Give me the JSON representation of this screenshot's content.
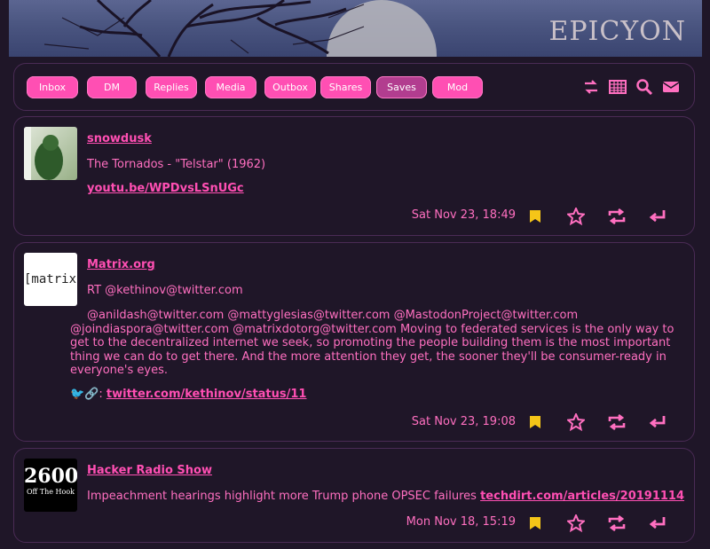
{
  "header": {
    "brand": "EPICYON"
  },
  "nav": {
    "tabs": [
      {
        "label": "Inbox"
      },
      {
        "label": "DM"
      },
      {
        "label": "Replies"
      },
      {
        "label": "Media"
      },
      {
        "label": "Outbox"
      },
      {
        "label": "Shares"
      },
      {
        "label": "Saves",
        "active": true
      },
      {
        "label": "Mod"
      }
    ],
    "icons": [
      "swap-icon",
      "calendar-icon",
      "search-icon",
      "email-icon"
    ]
  },
  "posts": [
    {
      "author": "snowdusk",
      "lines": [
        "The Tornados - \"Telstar\" (1962)"
      ],
      "link": "youtu.be/WPDvsLSnUGc",
      "time": "Sat Nov 23, 18:49"
    },
    {
      "author": "Matrix.org",
      "avatar_text": "[matrix]",
      "retweet": "RT @kethinov@twitter.com",
      "body": "@anildash@twitter.com @mattyglesias@twitter.com @MastodonProject@twitter.com @joindiaspora@twitter.com @matrixdotorg@twitter.com Moving to federated services is the only way to get to the decentralized internet we seek, so promoting the people building them is the most important thing we can do to get there. And the more attention they get, the sooner they'll be consumer-ready in everyone's eyes.",
      "link_prefix": "🐦🔗:",
      "link": "twitter.com/kethinov/status/11",
      "time": "Sat Nov 23, 19:08"
    },
    {
      "author": "Hacker Radio Show",
      "avatar_text": "2600",
      "avatar_sub": "Off The Hook",
      "line": "Impeachment hearings highlight more Trump phone OPSEC failures",
      "link": "techdirt.com/articles/20191114",
      "time": "Mon Nov 18, 15:19"
    }
  ],
  "colors": {
    "accent": "#ff4fb3",
    "bg": "#1f1628",
    "bookmark": "#f5c518"
  }
}
